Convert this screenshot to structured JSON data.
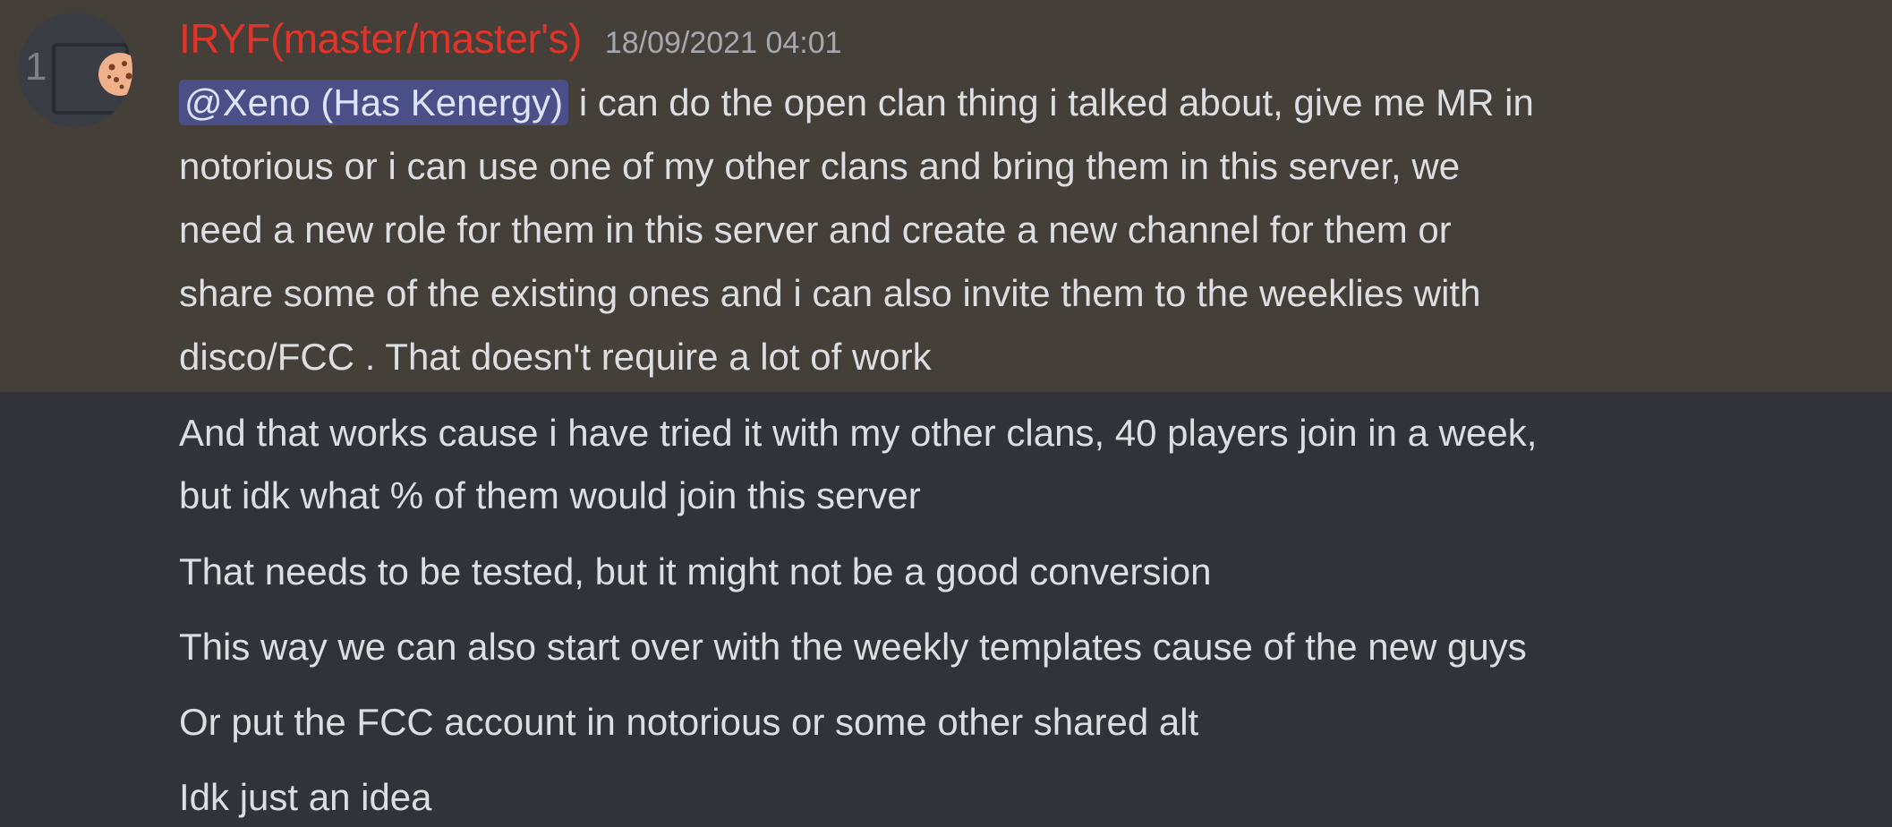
{
  "message": {
    "username": "IRYF(master/master's)",
    "timestamp": "18/09/2021 04:01",
    "avatar_badge": "1",
    "avatar_icon": "cookie-icon",
    "mention": "@Xeno (Has Kenergy)",
    "first_lines": [
      " i can do the open clan thing i talked about, give me MR in",
      "notorious or i can use one of my other clans and bring them in this server, we",
      "need a new role for them in this server and create a new channel for them or",
      "share some of the existing ones and i can also invite them to the weeklies with",
      "disco/FCC . That doesn't require a lot of work"
    ]
  },
  "followups": [
    "And that works cause i have tried it with my other clans, 40 players join in a week,",
    "but idk what % of them would join this server",
    "That needs to be tested, but it might not be a good conversion",
    "This way we can also start over with the weekly templates cause of the new guys",
    "Or put the FCC account in notorious or some other shared alt",
    "Idk just an idea"
  ],
  "colors": {
    "background": "#313338",
    "highlight": "#444039",
    "username": "#e0342b",
    "mention_bg": "#4a4f88"
  }
}
